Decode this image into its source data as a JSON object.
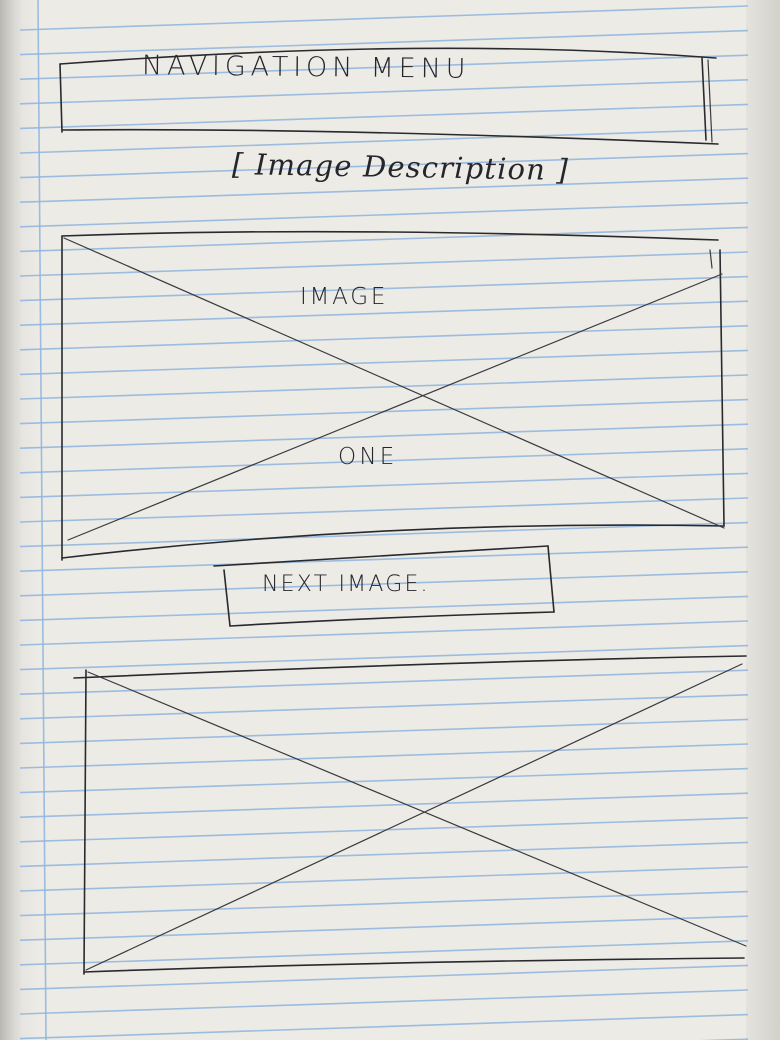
{
  "sketch": {
    "nav_menu_label": "NAVIGATION MENU",
    "image_description_label": "[ Image Description ]",
    "image_one": {
      "line1": "IMAGE",
      "line2": "ONE"
    },
    "next_button_label": "NEXT IMAGE."
  },
  "colors": {
    "paper": "#ecebe6",
    "ruled_line": "#8fb4de",
    "margin_line": "#e6b9b2",
    "pencil": "#2a2a2e"
  }
}
